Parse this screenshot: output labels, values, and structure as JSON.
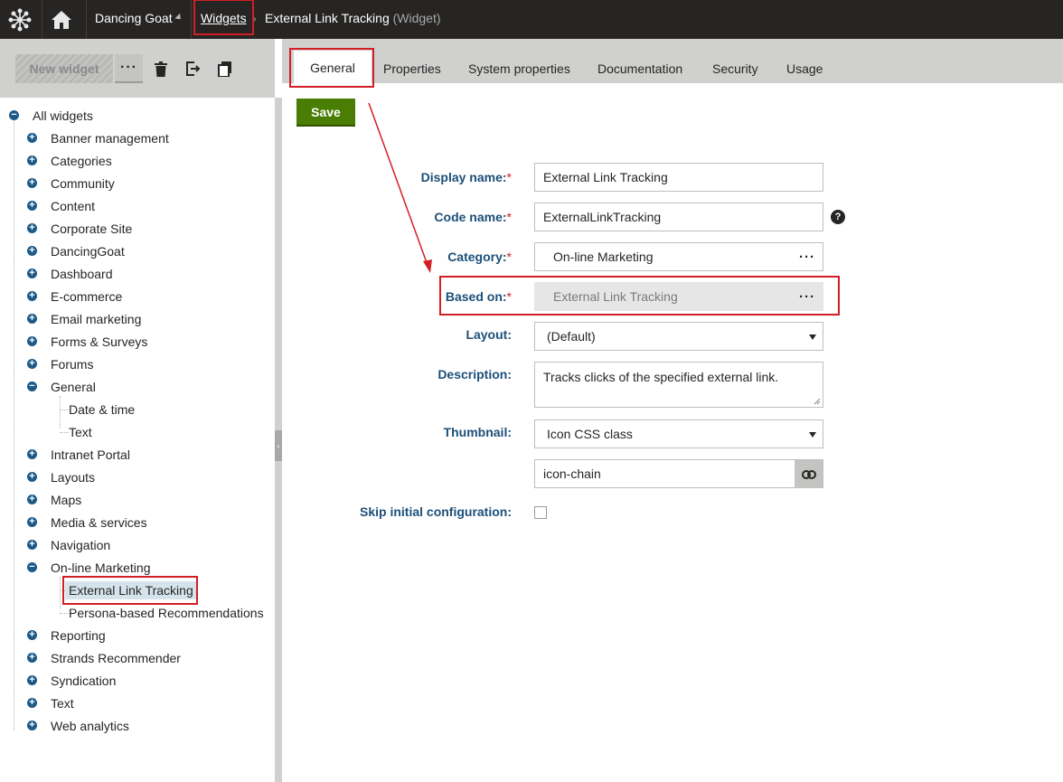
{
  "breadcrumb": {
    "site": "Dancing Goat",
    "section": "Widgets",
    "current": "External Link Tracking",
    "current_type": "(Widget)"
  },
  "left_toolbar": {
    "new_widget_label": "New widget",
    "more_label": "···"
  },
  "tree": {
    "root": "All widgets",
    "items": [
      {
        "label": "Banner management"
      },
      {
        "label": "Categories"
      },
      {
        "label": "Community"
      },
      {
        "label": "Content"
      },
      {
        "label": "Corporate Site"
      },
      {
        "label": "DancingGoat"
      },
      {
        "label": "Dashboard"
      },
      {
        "label": "E-commerce"
      },
      {
        "label": "Email marketing"
      },
      {
        "label": "Forms & Surveys"
      },
      {
        "label": "Forums"
      },
      {
        "label": "General",
        "children": [
          "Date & time",
          "Text"
        ]
      },
      {
        "label": "Intranet Portal"
      },
      {
        "label": "Layouts"
      },
      {
        "label": "Maps"
      },
      {
        "label": "Media & services"
      },
      {
        "label": "Navigation"
      },
      {
        "label": "On-line Marketing",
        "children": [
          "External Link Tracking",
          "Persona-based Recommendations"
        ]
      },
      {
        "label": "Reporting"
      },
      {
        "label": "Strands Recommender"
      },
      {
        "label": "Syndication"
      },
      {
        "label": "Text"
      },
      {
        "label": "Web analytics"
      }
    ]
  },
  "tabs": [
    "General",
    "Properties",
    "System properties",
    "Documentation",
    "Security",
    "Usage"
  ],
  "active_tab": "General",
  "save_label": "Save",
  "form": {
    "display_name": {
      "label": "Display name:",
      "value": "External Link Tracking"
    },
    "code_name": {
      "label": "Code name:",
      "value": "ExternalLinkTracking"
    },
    "category": {
      "label": "Category:",
      "value": "On-line Marketing"
    },
    "based_on": {
      "label": "Based on:",
      "value": "External Link Tracking"
    },
    "layout": {
      "label": "Layout:",
      "value": "(Default)"
    },
    "description": {
      "label": "Description:",
      "value": "Tracks clicks of the specified external link."
    },
    "thumbnail": {
      "label": "Thumbnail:",
      "value": "Icon CSS class",
      "css_class": "icon-chain"
    },
    "skip_config": {
      "label": "Skip initial configuration:",
      "checked": false
    },
    "required_mark": "*",
    "help_mark": "?"
  },
  "colors": {
    "topbar": "#262524",
    "save_button": "#497d04",
    "label_blue": "#1c4f7a",
    "highlight": "#d21f26",
    "selected_node": "#d5e4ec"
  },
  "icons": [
    "kentico-logo-icon",
    "home-icon",
    "delete-icon",
    "export-icon",
    "clone-icon",
    "help-icon",
    "link-icon",
    "dropdown-arrow-icon",
    "ellipsis-icon"
  ]
}
